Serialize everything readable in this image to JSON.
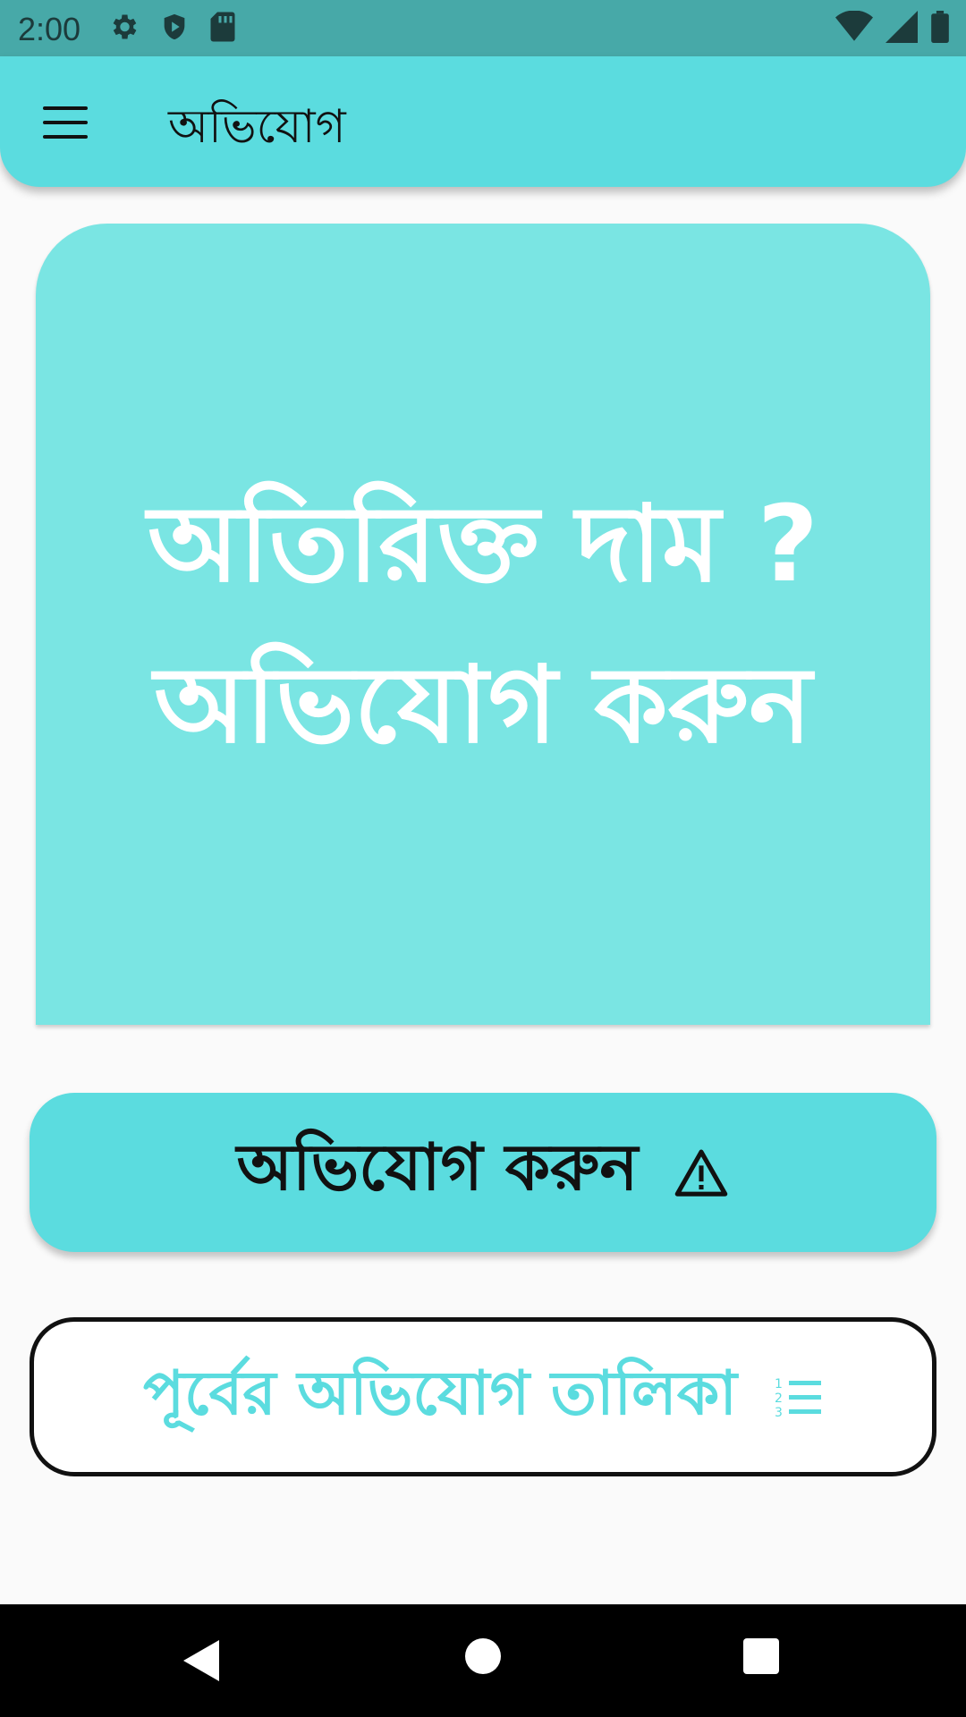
{
  "status_bar": {
    "time": "2:00"
  },
  "app_bar": {
    "title": "অভিযোগ"
  },
  "hero": {
    "line1": "অতিরিক্ত দাম ?",
    "line2": "অভিযোগ করুন"
  },
  "buttons": {
    "complain_label": "অভিযোগ করুন",
    "history_label": "পূর্বের অভিযোগ তালিকা"
  },
  "colors": {
    "status_bar": "#47a9a8",
    "accent": "#5bdcdf",
    "hero_bg": "#7ae5e3"
  },
  "icons": {
    "menu": "hamburger-icon",
    "complain": "warning-icon",
    "history": "numbered-list-icon"
  }
}
